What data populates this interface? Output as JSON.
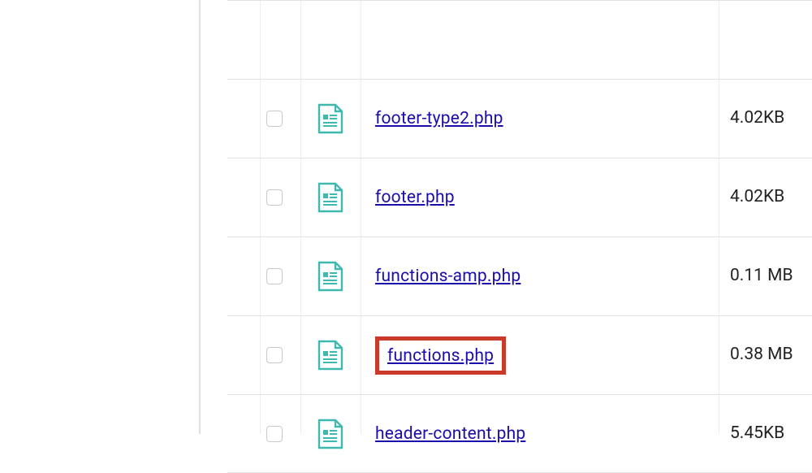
{
  "files": [
    {
      "name": "footer-type2.php",
      "size": "4.02KB",
      "highlighted": false
    },
    {
      "name": "footer.php",
      "size": "4.02KB",
      "highlighted": false
    },
    {
      "name": "functions-amp.php",
      "size": "0.11 MB",
      "highlighted": false
    },
    {
      "name": "functions.php",
      "size": "0.38 MB",
      "highlighted": true
    },
    {
      "name": "header-content.php",
      "size": "5.45KB",
      "highlighted": false
    }
  ],
  "colors": {
    "link": "#1a0dab",
    "highlight": "#c93a2a",
    "icon": "#3fb8af"
  }
}
